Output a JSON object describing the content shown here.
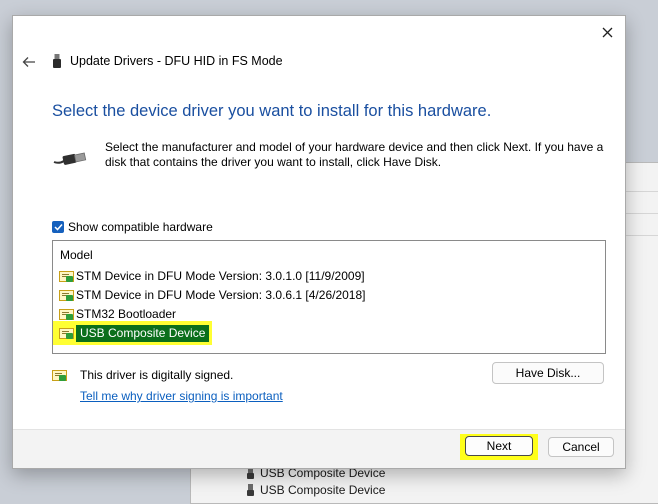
{
  "dialog": {
    "title": "Update Drivers - DFU HID in FS Mode",
    "heading": "Select the device driver you want to install for this hardware.",
    "description": "Select the manufacturer and model of your hardware device and then click Next. If you have a disk that contains the driver you want to install, click Have Disk.",
    "show_compatible_label": "Show compatible hardware",
    "show_compatible_checked": true,
    "list": {
      "header": "Model",
      "items": [
        "STM Device in DFU Mode Version: 3.0.1.0 [11/9/2009]",
        "STM Device in DFU Mode Version: 3.0.6.1 [4/26/2018]",
        "STM32 Bootloader",
        "USB Composite Device"
      ],
      "selected_index": 3
    },
    "signed_text": "This driver is digitally signed.",
    "signing_link": "Tell me why driver signing is important",
    "have_disk_label": "Have Disk...",
    "next_label": "Next",
    "cancel_label": "Cancel"
  },
  "background": {
    "items": [
      "USB Composite Device",
      "USB Composite Device"
    ]
  },
  "colors": {
    "heading": "#1a4fa0",
    "link": "#0b5fbf",
    "highlight": "#ffff33",
    "selection": "#0b6f1b",
    "checkbox": "#1560bd"
  },
  "icons": {
    "close": "close-icon",
    "back": "back-arrow-icon",
    "device": "usb-device-icon",
    "usb_cable": "usb-cable-icon",
    "driver": "driver-package-icon",
    "signed": "signed-driver-icon"
  }
}
